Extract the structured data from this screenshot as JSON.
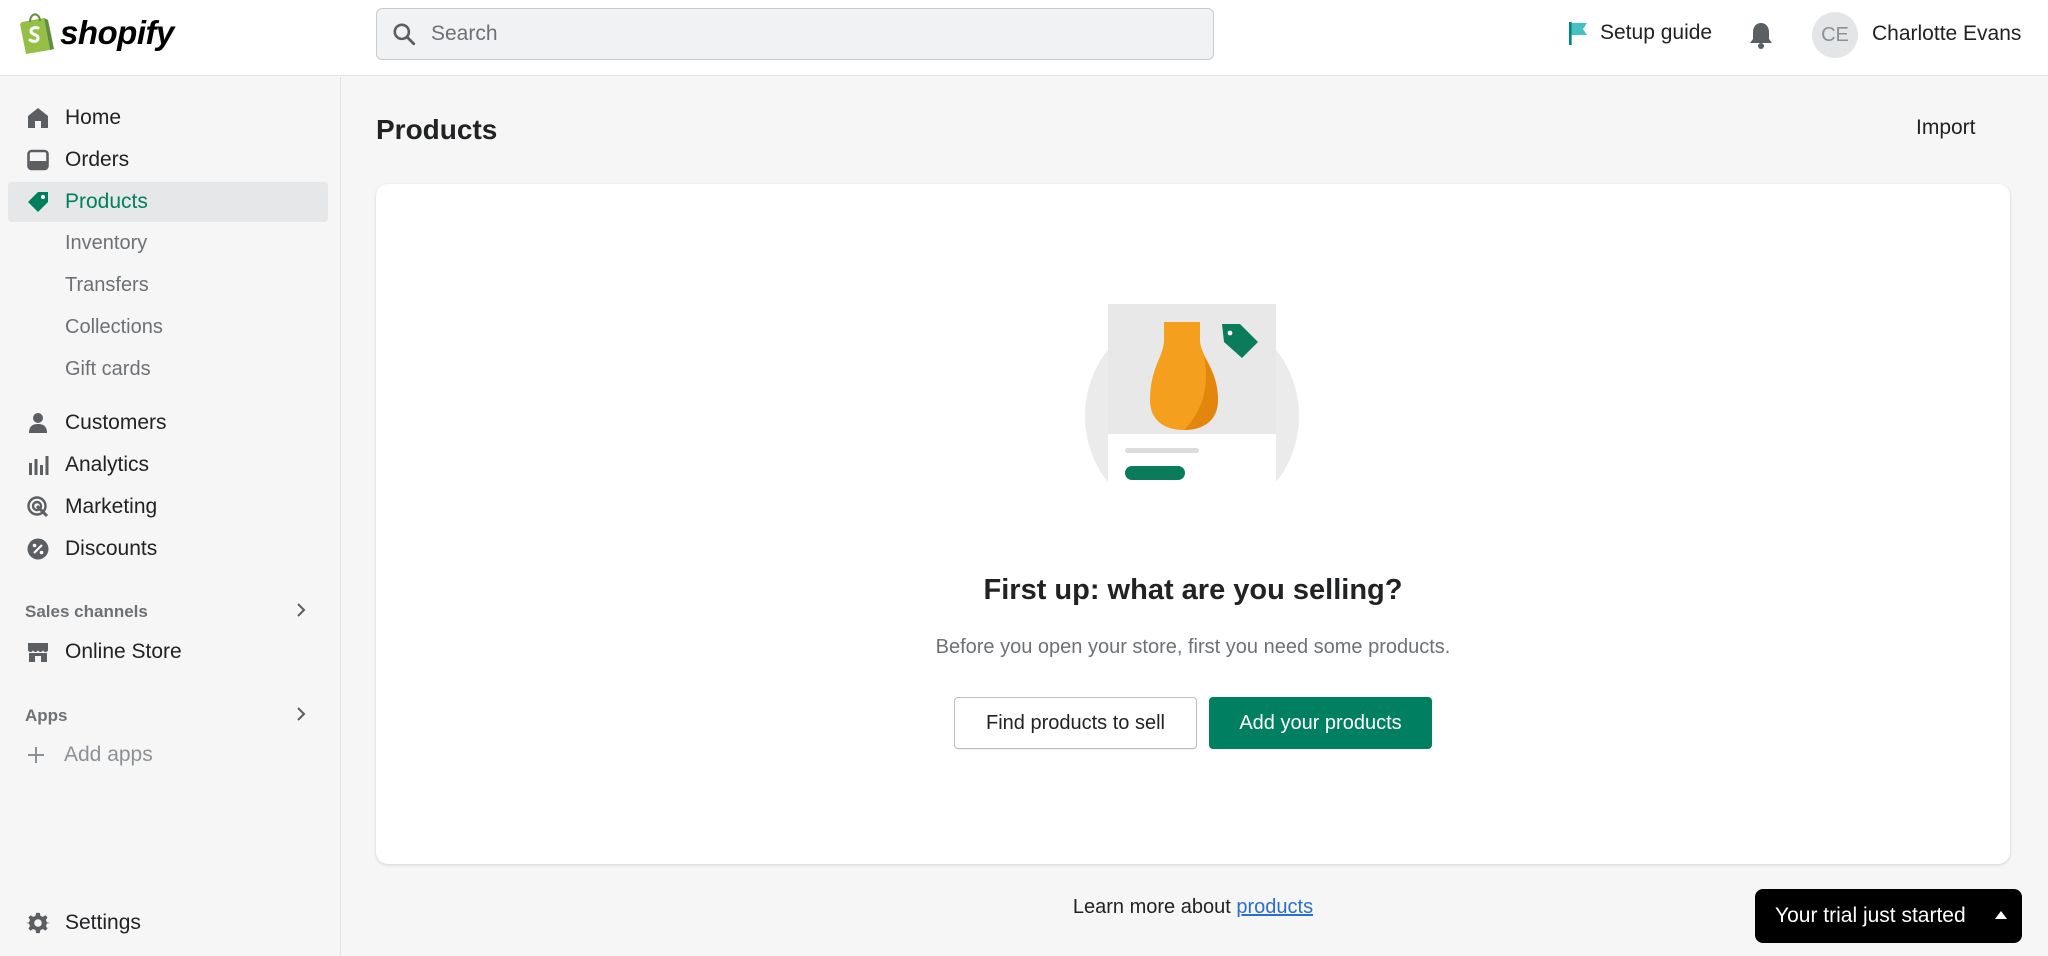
{
  "brand": {
    "name": "shopify",
    "color": "#95bf47"
  },
  "header": {
    "search_placeholder": "Search",
    "setup_guide": "Setup guide",
    "avatar_initials": "CE",
    "user_name": "Charlotte Evans"
  },
  "sidebar": {
    "items": [
      {
        "label": "Home",
        "icon": "home-icon"
      },
      {
        "label": "Orders",
        "icon": "inbox-icon"
      },
      {
        "label": "Products",
        "icon": "tag-icon",
        "active": true
      },
      {
        "label": "Customers",
        "icon": "person-icon"
      },
      {
        "label": "Analytics",
        "icon": "bar-chart-icon"
      },
      {
        "label": "Marketing",
        "icon": "target-icon"
      },
      {
        "label": "Discounts",
        "icon": "discount-icon"
      }
    ],
    "product_subitems": [
      "Inventory",
      "Transfers",
      "Collections",
      "Gift cards"
    ],
    "sales_channels": {
      "heading": "Sales channels",
      "items": [
        {
          "label": "Online Store",
          "icon": "store-icon"
        }
      ]
    },
    "apps": {
      "heading": "Apps",
      "add_label": "Add apps"
    },
    "settings": "Settings"
  },
  "main": {
    "title": "Products",
    "import_label": "Import",
    "empty_state": {
      "heading": "First up: what are you selling?",
      "description": "Before you open your store, first you need some products.",
      "secondary_action": "Find products to sell",
      "primary_action": "Add your products"
    },
    "learn_more_prefix": "Learn more about",
    "learn_more_link": "products"
  },
  "trial_banner": "Your trial just started",
  "colors": {
    "accent": "#008060",
    "active_text": "#007f5f",
    "link": "#2c6ecb"
  }
}
